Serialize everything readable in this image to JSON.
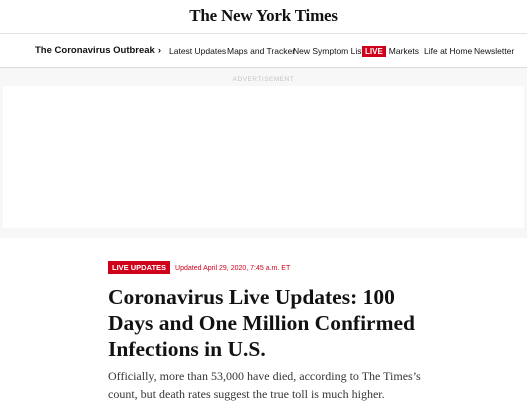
{
  "header": {
    "masthead": "The New York Times"
  },
  "nav": {
    "section_title": "The Coronavirus Outbreak",
    "chevron": "›",
    "items": [
      "Latest Updates",
      "Maps and Tracker",
      "New Symptom List",
      "Markets",
      "Life at Home",
      "Newsletter"
    ],
    "live_badge": "LIVE"
  },
  "ad": {
    "label": "ADVERTISEMENT"
  },
  "article": {
    "live_badge": "LIVE UPDATES",
    "updated": "Updated April 29, 2020, 7:45 a.m. ET",
    "headline": "Coronavirus Live Updates: 100 Days and One Million Confirmed Infections in U.S.",
    "summary": "Officially, more than 53,000 have died, according to The Times’s count, but death rates suggest the true toll is much higher."
  },
  "colors": {
    "accent_red": "#d0021b",
    "text": "#121212"
  }
}
